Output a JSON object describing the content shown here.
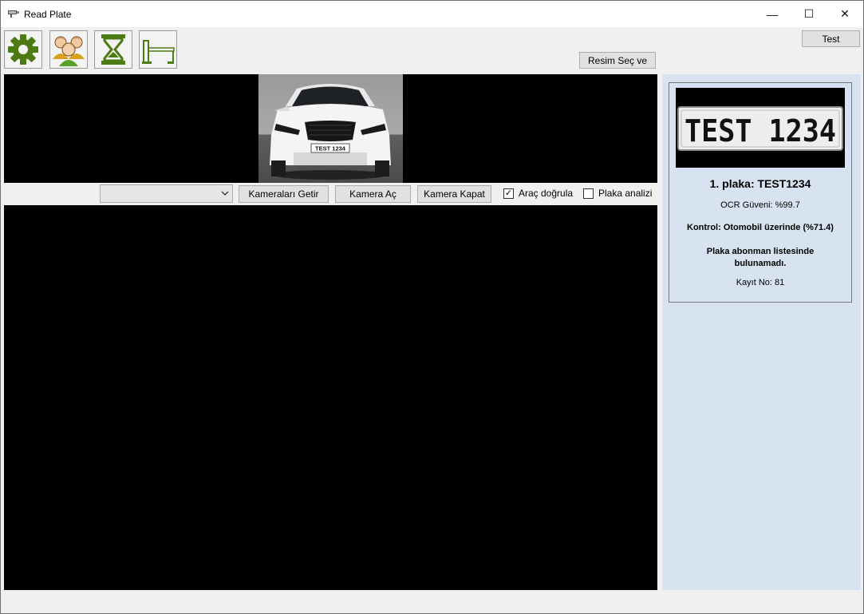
{
  "window": {
    "title": "Read Plate",
    "minimize_glyph": "—",
    "maximize_glyph": "☐",
    "close_glyph": "✕"
  },
  "toolbar": {
    "icons": [
      "gear-icon",
      "users-icon",
      "hourglass-icon",
      "barrier-gate-icon"
    ],
    "accent_color": "#4c7a13",
    "test_label": "Test",
    "select_image_label": "Resim Seç ve"
  },
  "image": {
    "plate_text": "TEST 1234"
  },
  "camera_controls": {
    "camera_select_value": "",
    "get_cameras_label": "Kameraları Getir",
    "open_camera_label": "Kamera Aç",
    "close_camera_label": "Kamera Kapat",
    "verify_vehicle_label": "Araç doğrula",
    "verify_vehicle_checked": true,
    "plate_analysis_label": "Plaka analizi",
    "plate_analysis_checked": false
  },
  "result": {
    "plate_image_text": "TEST 1234",
    "plate_line": "1. plaka: TEST1234",
    "ocr_confidence": "OCR Güveni: %99.7",
    "control": "Kontrol: Otomobil üzerinde (%71.4)",
    "subscriber_status": "Plaka abonman listesinde bulunamadı.",
    "record_no": "Kayıt No: 81",
    "panel_color": "#d7e3f1"
  }
}
